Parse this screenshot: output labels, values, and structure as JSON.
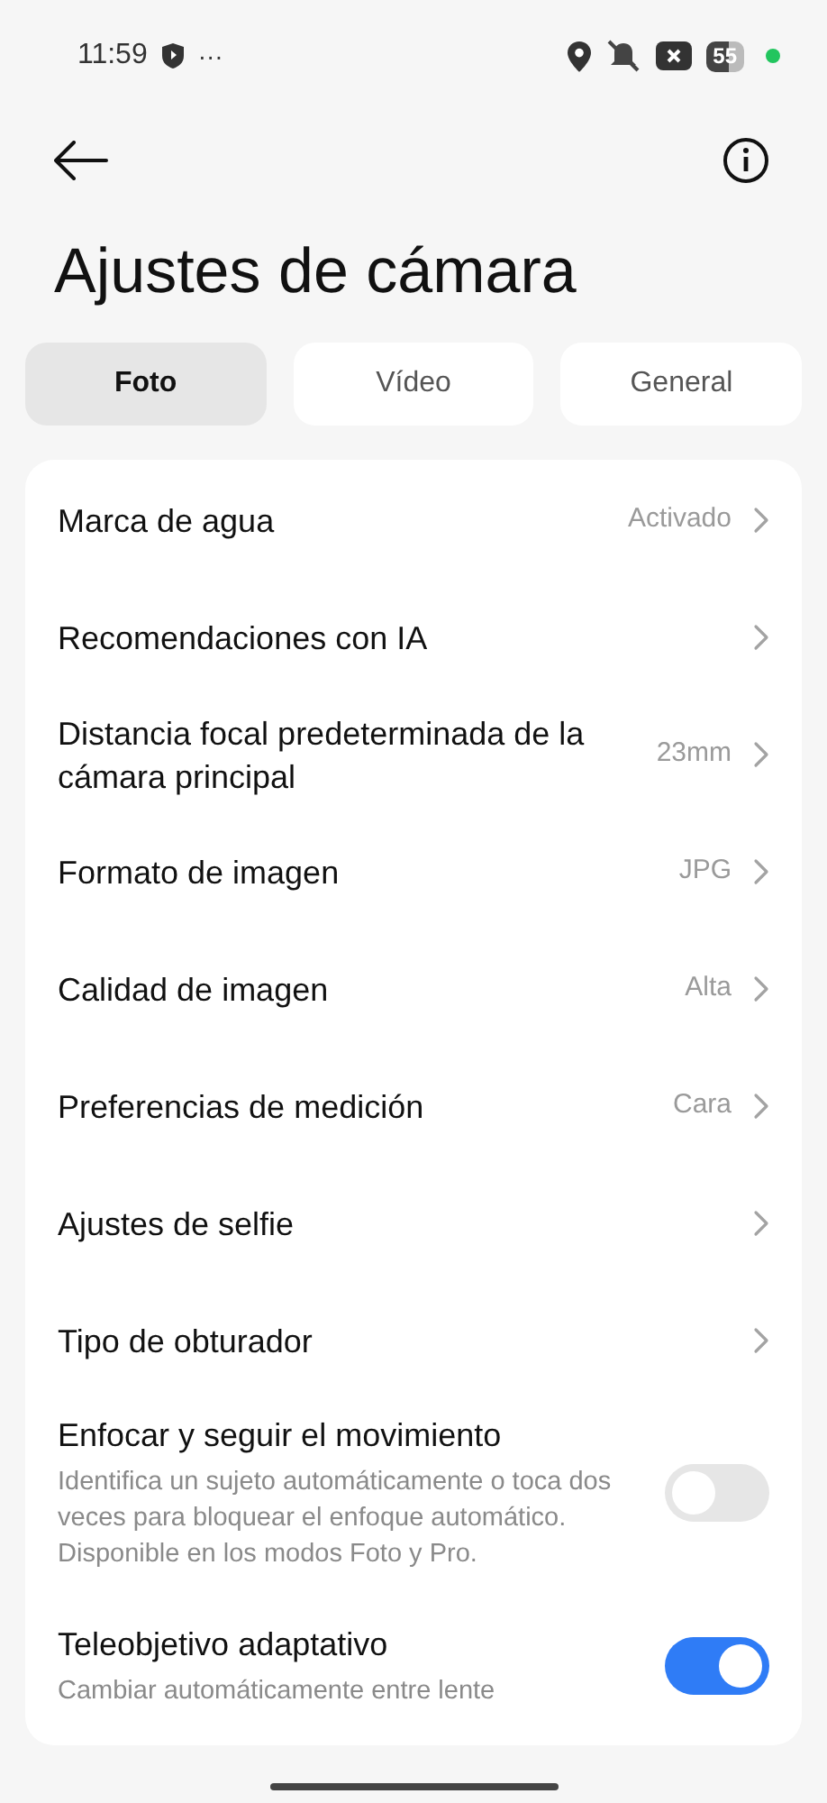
{
  "status_bar": {
    "time": "11:59",
    "more": "···",
    "battery": "55"
  },
  "title": "Ajustes de cámara",
  "tabs": [
    {
      "label": "Foto",
      "selected": true
    },
    {
      "label": "Vídeo",
      "selected": false
    },
    {
      "label": "General",
      "selected": false
    }
  ],
  "settings": [
    {
      "kind": "link",
      "label": "Marca de agua",
      "value": "Activado"
    },
    {
      "kind": "link",
      "label": "Recomendaciones con IA"
    },
    {
      "kind": "link",
      "label": "Distancia focal predeterminada de la cámara principal",
      "value": "23mm"
    },
    {
      "kind": "link",
      "label": "Formato de imagen",
      "value": "JPG"
    },
    {
      "kind": "link",
      "label": "Calidad de imagen",
      "value": "Alta"
    },
    {
      "kind": "link",
      "label": "Preferencias de medición",
      "value": "Cara"
    },
    {
      "kind": "link",
      "label": "Ajustes de selfie"
    },
    {
      "kind": "link",
      "label": "Tipo de obturador"
    },
    {
      "kind": "toggle",
      "label": "Enfocar y seguir el movimiento",
      "description": "Identifica un sujeto automáticamente o toca dos veces para bloquear el enfoque automático. Disponible en los modos Foto y Pro.",
      "on": false
    },
    {
      "kind": "toggle",
      "label": "Teleobjetivo adaptativo",
      "description": "Cambiar automáticamente entre lente",
      "on": true
    }
  ]
}
